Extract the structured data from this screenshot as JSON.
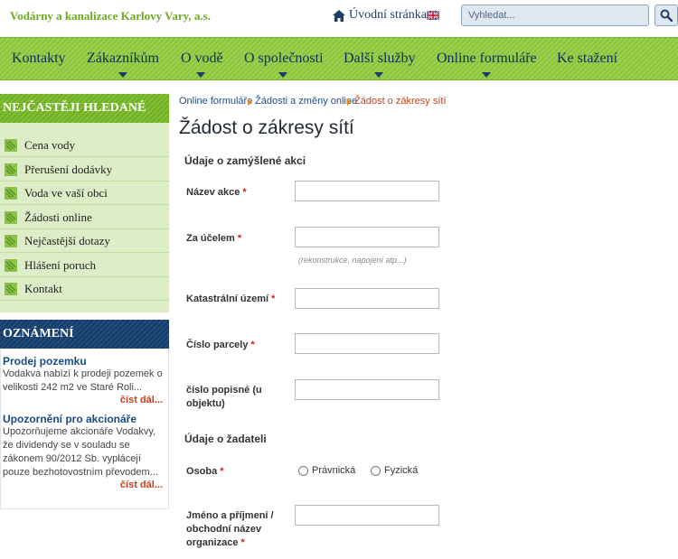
{
  "header": {
    "brand": "Vodárny a kanalizace Karlovy Vary, a.s.",
    "home_label": "Úvodní stránka",
    "search_placeholder": "Vyhledat..."
  },
  "nav": {
    "items": [
      {
        "label": "Kontakty"
      },
      {
        "label": "Zákazníkům"
      },
      {
        "label": "O vodě"
      },
      {
        "label": "O společnosti"
      },
      {
        "label": "Další služby"
      },
      {
        "label": "Online formuláře"
      },
      {
        "label": "Ke stažení"
      }
    ]
  },
  "sidebar": {
    "frequent_title": "NEJČASTĚJI HLEDANÉ",
    "items": [
      {
        "label": "Cena vody"
      },
      {
        "label": "Přerušení dodávky"
      },
      {
        "label": "Voda ve vaší obci"
      },
      {
        "label": "Žádosti online"
      },
      {
        "label": "Nejčastější dotazy"
      },
      {
        "label": "Hlášení poruch"
      },
      {
        "label": "Kontakt"
      }
    ],
    "news_title": "OZNÁMENÍ",
    "news": [
      {
        "title": "Prodej pozemku",
        "text": "Vodakva nabízí k prodeji pozemek o velikosti 242 m2 ve Staré Roli...",
        "more": "číst dál..."
      },
      {
        "title": "Upozornění pro akcionáře",
        "text": "Upozorňujeme akcionáře Vodakvy, že dividendy se v souladu se zákonem 90/2012 Sb. vyplácejí pouze bezhotovostním převodem...",
        "more": "číst dál..."
      }
    ]
  },
  "breadcrumb": {
    "items": [
      {
        "label": "Online formuláře"
      },
      {
        "label": "Žádosti a změny online"
      },
      {
        "label": "Žádost o zákresy sítí"
      }
    ]
  },
  "main": {
    "title": "Žádost o zákresy sítí",
    "section1": "Údaje o zamýšlené akci",
    "section2": "Údaje o žadateli",
    "required_mark": "*",
    "fields": {
      "nazev_akce": {
        "label": "Název akce",
        "value": ""
      },
      "za_ucelem": {
        "label": "Za účelem",
        "value": "",
        "hint": "(rekonstrukce, napojení atp...)"
      },
      "katastralni_uzemi": {
        "label": "Katastrální území",
        "value": ""
      },
      "cislo_parcely": {
        "label": "Číslo parcely",
        "value": ""
      },
      "cislo_popisne": {
        "label": "číslo popisné (u objektu)",
        "value": ""
      },
      "osoba": {
        "label": "Osoba",
        "options": [
          "Právnická",
          "Fyzická"
        ],
        "selected": ""
      },
      "jmeno": {
        "label": "Jméno a příjmení / obchodní název organizace",
        "value": ""
      }
    }
  },
  "colors": {
    "brand_green": "#6cab1f",
    "nav_green": "#8bc43f",
    "navy": "#173a66",
    "link_blue": "#1c4f8a",
    "accent_red": "#c4401f"
  }
}
